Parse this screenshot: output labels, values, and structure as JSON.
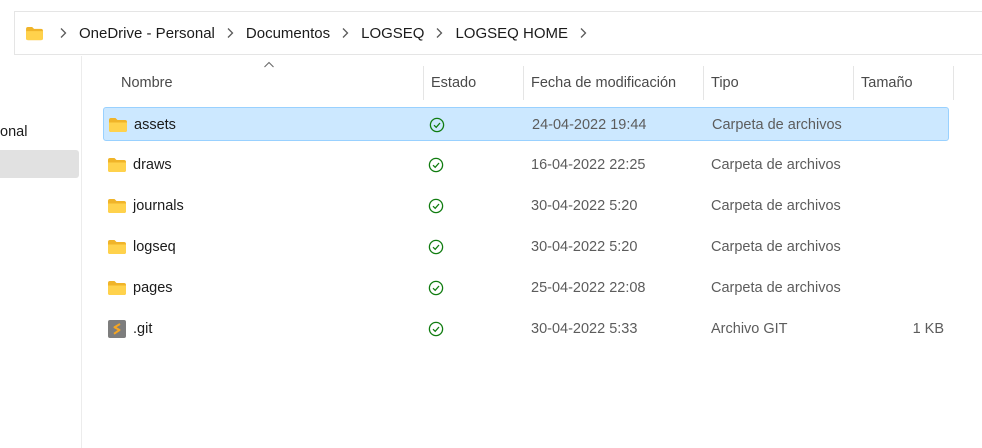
{
  "breadcrumb": [
    "OneDrive - Personal",
    "Documentos",
    "LOGSEQ",
    "LOGSEQ HOME"
  ],
  "nav": {
    "item_partial": "onal"
  },
  "columns": {
    "name": "Nombre",
    "status": "Estado",
    "modified": "Fecha de modificación",
    "type": "Tipo",
    "size": "Tamaño"
  },
  "files": [
    {
      "name": "assets",
      "modified": "24-04-2022 19:44",
      "type": "Carpeta de archivos",
      "size": "",
      "icon": "folder-icon",
      "selected": true
    },
    {
      "name": "draws",
      "modified": "16-04-2022 22:25",
      "type": "Carpeta de archivos",
      "size": "",
      "icon": "folder-icon"
    },
    {
      "name": "journals",
      "modified": "30-04-2022 5:20",
      "type": "Carpeta de archivos",
      "size": "",
      "icon": "folder-icon"
    },
    {
      "name": "logseq",
      "modified": "30-04-2022 5:20",
      "type": "Carpeta de archivos",
      "size": "",
      "icon": "folder-icon"
    },
    {
      "name": "pages",
      "modified": "25-04-2022 22:08",
      "type": "Carpeta de archivos",
      "size": "",
      "icon": "folder-icon"
    },
    {
      "name": ".git",
      "modified": "30-04-2022 5:33",
      "type": "Archivo GIT",
      "size": "1 KB",
      "icon": "git-file-icon"
    }
  ],
  "colors": {
    "selection": "#cce8ff",
    "selection_border": "#99d1ff",
    "status_ok": "#107c10",
    "folder": "#f8c846"
  }
}
